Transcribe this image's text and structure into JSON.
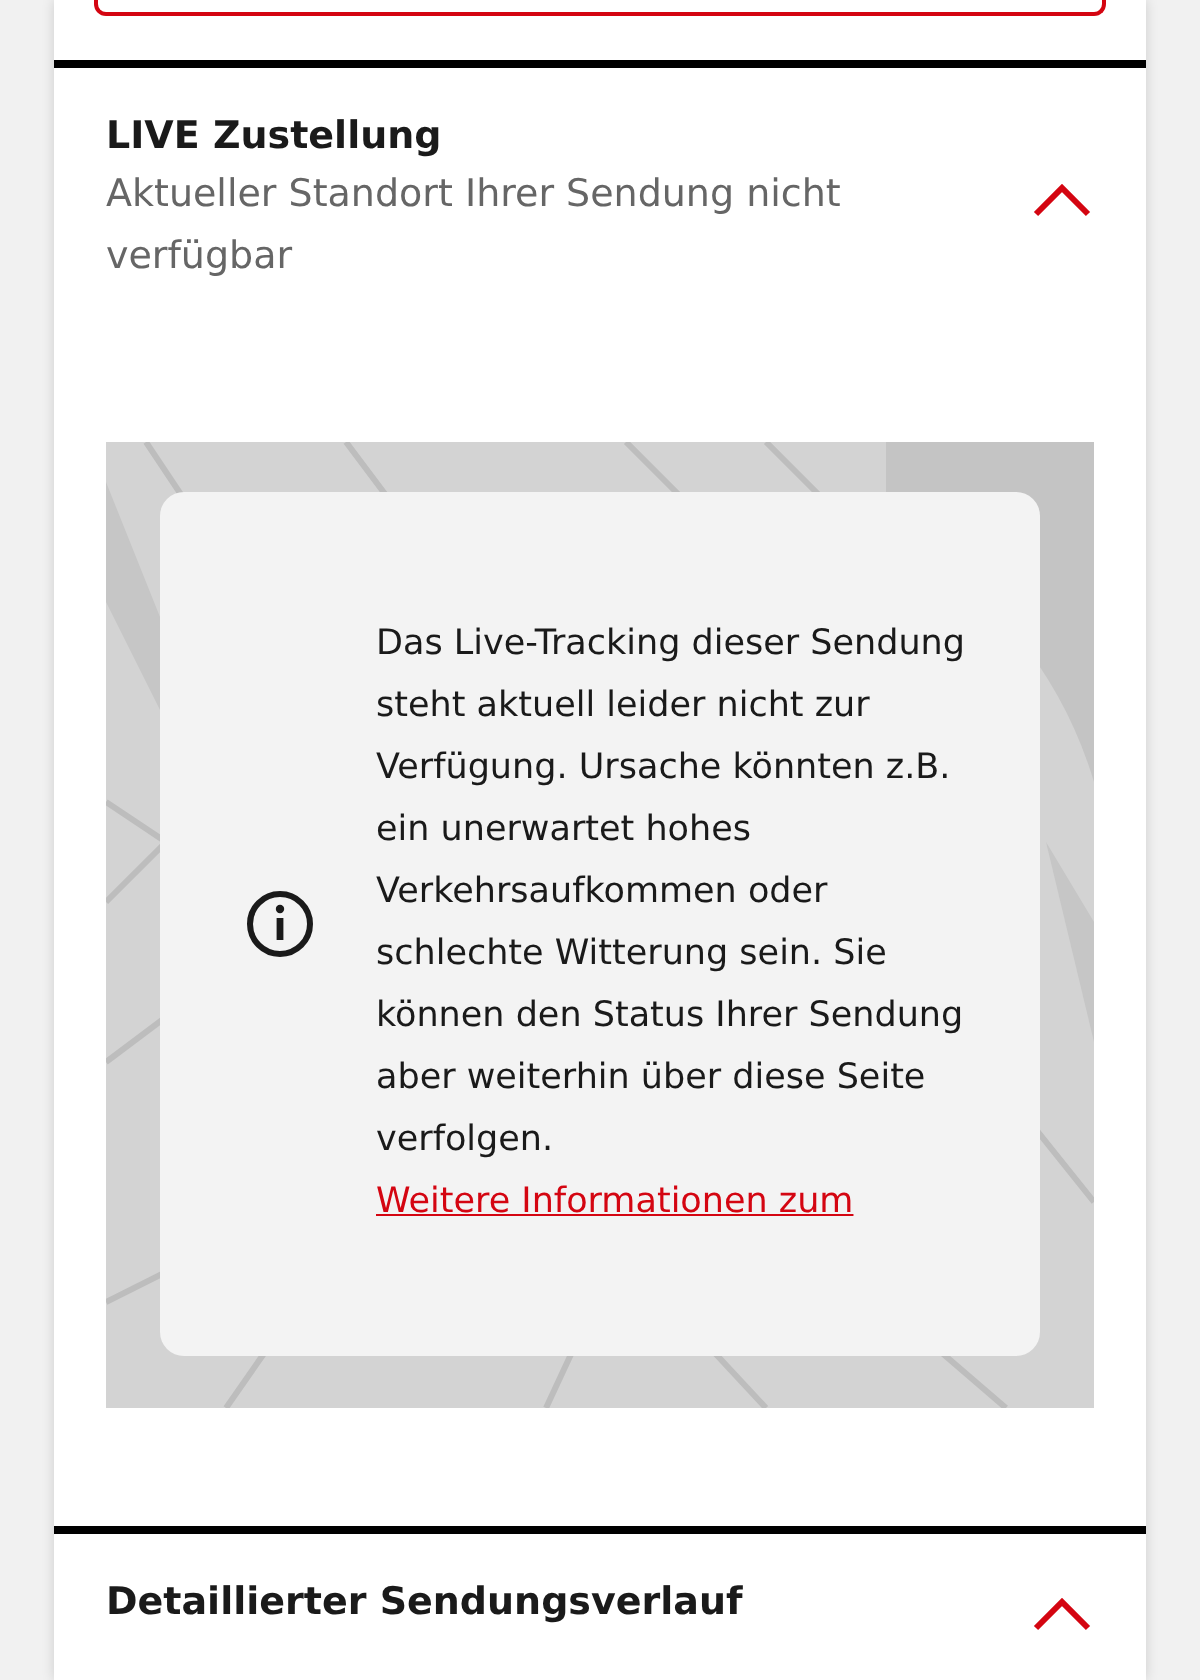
{
  "sections": [
    {
      "title": "LIVE Zustellung",
      "subtitle": "Aktueller Standort Ihrer Sendung nicht verfügbar",
      "expanded": true,
      "kind": "map",
      "notice": {
        "text": "Das Live-Tracking dieser Sendung steht aktuell leider nicht zur Verfügung. Ursache könnten z.B. ein unerwartet hohes Verkehrsaufkommen oder schlechte Witterung sein. Sie können den Status Ihrer Sendung aber weiterhin über diese Seite verfolgen.",
        "link": "Weitere Informationen zum"
      }
    },
    {
      "title": "Detaillierter Sendungsverlauf",
      "expanded": true,
      "kind": "plain"
    }
  ]
}
